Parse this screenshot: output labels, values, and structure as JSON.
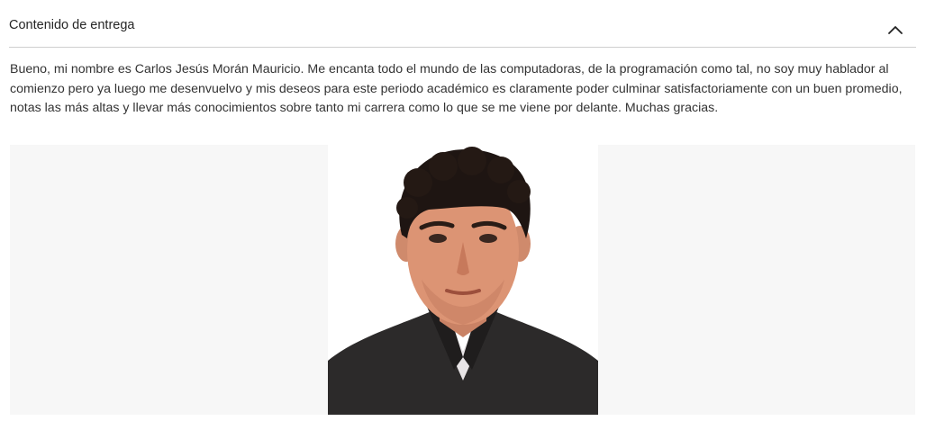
{
  "section": {
    "title": "Contenido de entrega",
    "toggle_icon": "chevron-up-icon"
  },
  "submission": {
    "text": "Bueno, mi nombre es Carlos Jesús Morán Mauricio. Me encanta todo el mundo de las computadoras, de la programación como tal, no soy muy hablador al comienzo pero ya luego me desenvuelvo y mis deseos para este periodo académico es claramente poder culminar satisfactoriamente con un buen promedio, notas las más altas y llevar más conocimientos sobre tanto mi carrera como lo que se me viene por delante. Muchas gracias."
  },
  "colors": {
    "frame_background": "#f7f7f7",
    "divider": "#cfcfcf",
    "text": "#333333"
  }
}
